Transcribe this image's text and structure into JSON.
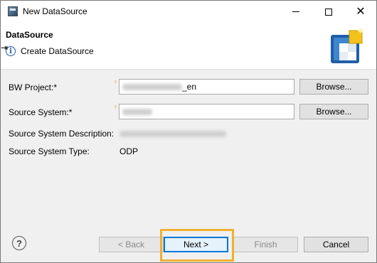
{
  "window": {
    "title": "New DataSource",
    "icon": "app-icon"
  },
  "header": {
    "title": "DataSource",
    "message": "Create DataSource",
    "message_icon": "info-icon"
  },
  "form": {
    "bw_project_label": "BW Project:*",
    "bw_project_value_suffix": "_en",
    "source_system_label": "Source System:*",
    "browse_label": "Browse...",
    "source_system_description_label": "Source System Description:",
    "source_system_type_label": "Source System Type:",
    "source_system_type_value": "ODP"
  },
  "footer": {
    "help_label": "?",
    "back_label": "< Back",
    "next_label": "Next >",
    "finish_label": "Finish",
    "cancel_label": "Cancel"
  },
  "colors": {
    "highlight": "#f0b030",
    "focus_border": "#0078d7",
    "required_marker": "#d89a1e"
  }
}
